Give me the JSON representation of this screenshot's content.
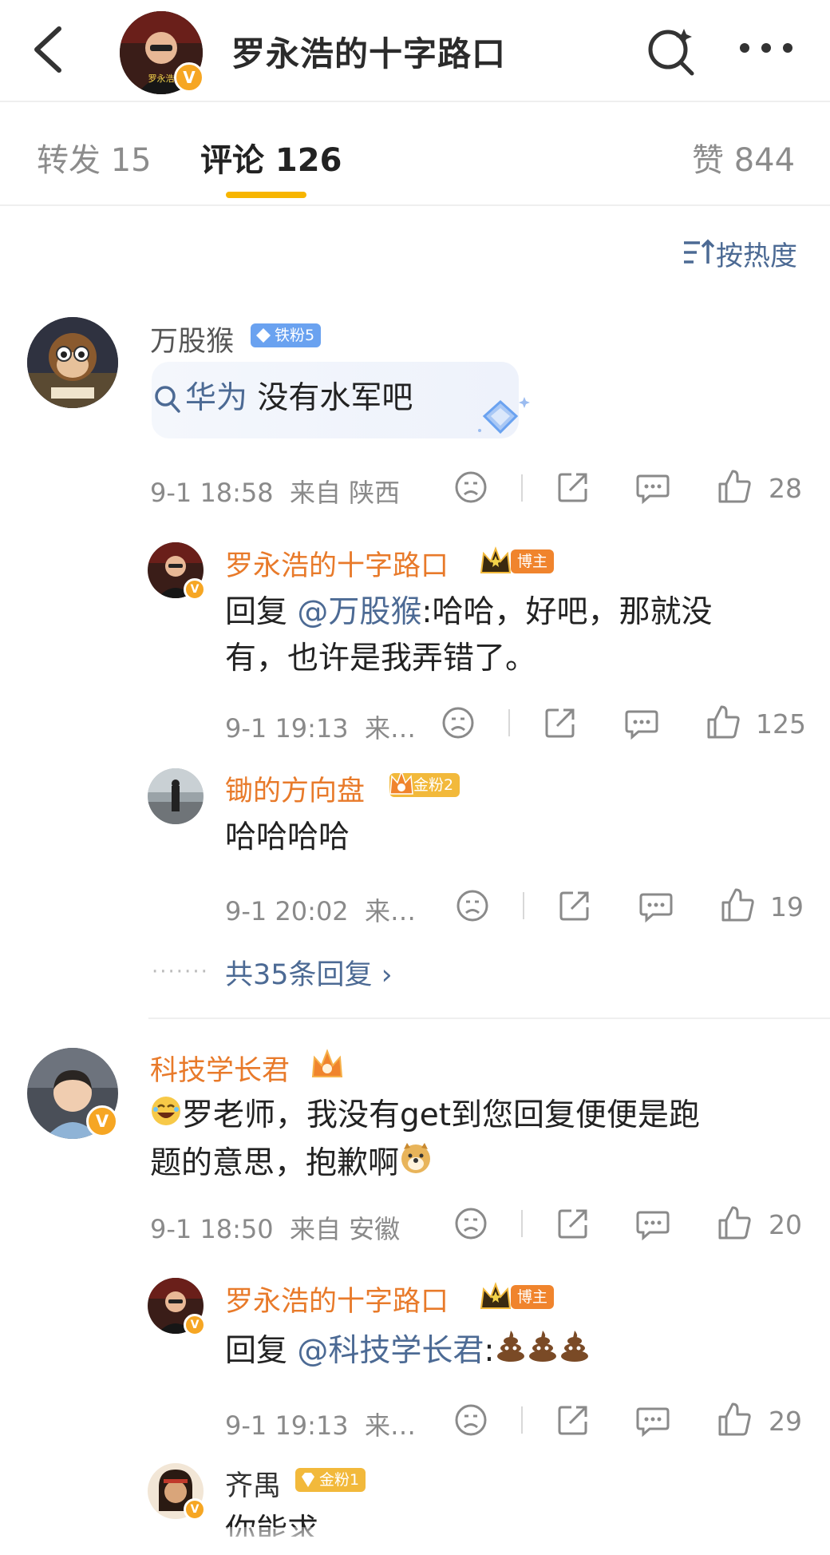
{
  "header": {
    "title": "罗永浩的十字路口",
    "avatar_caption": "罗永浩的十字路口"
  },
  "tabs": [
    {
      "label": "转发 15"
    },
    {
      "label": "评论 126"
    },
    {
      "label": "赞 844"
    }
  ],
  "sort_label": "按热度",
  "comments": [
    {
      "user": "万股猴",
      "badge": "铁粉5",
      "text_link": "华为",
      "text": " 没有水军吧",
      "time": "9-1 18:58",
      "location": "来自 陕西",
      "likes": "28",
      "replies": [
        {
          "user": "罗永浩的十字路口",
          "badge": "博主",
          "reply_prefix": "回复 ",
          "mention": "@万股猴",
          "text_line1": ":哈哈，好吧，那就没",
          "text_line2": "有，也许是我弄错了。",
          "time": "9-1 19:13",
          "location": "来…",
          "likes": "125"
        },
        {
          "user": "锄的方向盘",
          "badge": "金粉2",
          "text": "哈哈哈哈",
          "time": "9-1 20:02",
          "location": "来…",
          "likes": "19"
        }
      ],
      "more_replies": "共35条回复 ›"
    },
    {
      "user": "科技学长君",
      "text_line1": "罗老师，我没有get到您回复便便是跑",
      "text_line2": "题的意思，抱歉啊",
      "time": "9-1 18:50",
      "location": "来自 安徽",
      "likes": "20",
      "replies": [
        {
          "user": "罗永浩的十字路口",
          "badge": "博主",
          "reply_prefix": "回复 ",
          "mention": "@科技学长君",
          "text": ":",
          "time": "9-1 19:13",
          "location": "来…",
          "likes": "29"
        },
        {
          "user": "齐禺",
          "badge": "金粉1",
          "text": "你能求"
        }
      ]
    }
  ],
  "colors": {
    "accent": "#f7b500",
    "link": "#4c6a94",
    "host_name": "#e87a2a"
  }
}
